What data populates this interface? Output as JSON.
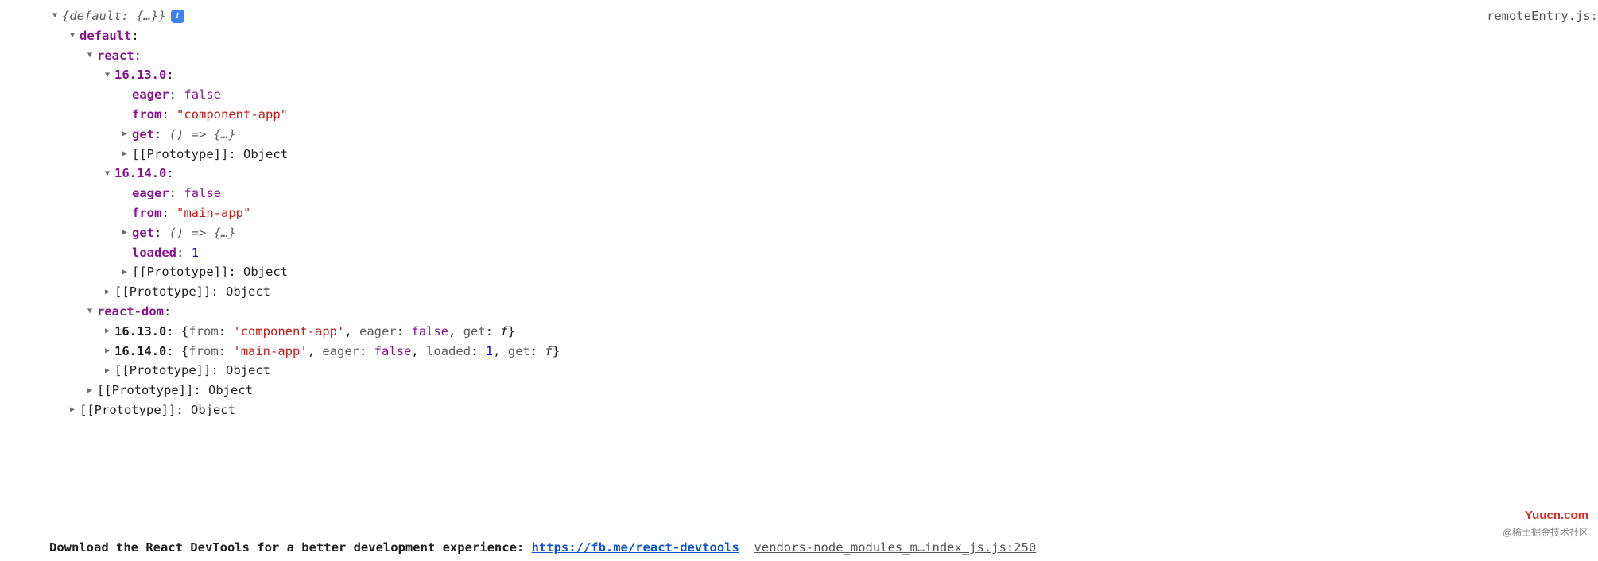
{
  "source_link": "remoteEntry.js:",
  "root": {
    "summary_prefix": "{default: ",
    "summary_inner": "{…}",
    "summary_suffix": "}",
    "info_badge": "i"
  },
  "default": {
    "key": "default",
    "react": {
      "key": "react",
      "v16_13_0": {
        "key": "16.13.0",
        "eager_key": "eager",
        "eager_val": "false",
        "from_key": "from",
        "from_val": "\"component-app\"",
        "get_key": "get",
        "get_val": "() => {…}",
        "proto_key": "[[Prototype]]",
        "proto_val": "Object"
      },
      "v16_14_0": {
        "key": "16.14.0",
        "eager_key": "eager",
        "eager_val": "false",
        "from_key": "from",
        "from_val": "\"main-app\"",
        "get_key": "get",
        "get_val": "() => {…}",
        "loaded_key": "loaded",
        "loaded_val": "1",
        "proto_key": "[[Prototype]]",
        "proto_val": "Object"
      },
      "proto_key": "[[Prototype]]",
      "proto_val": "Object"
    },
    "react_dom": {
      "key": "react-dom",
      "v16_13_0": {
        "key": "16.13.0",
        "inline_from_k": "from",
        "inline_from_v": "'component-app'",
        "inline_eager_k": "eager",
        "inline_eager_v": "false",
        "inline_get_k": "get",
        "inline_get_v": "f"
      },
      "v16_14_0": {
        "key": "16.14.0",
        "inline_from_k": "from",
        "inline_from_v": "'main-app'",
        "inline_eager_k": "eager",
        "inline_eager_v": "false",
        "inline_loaded_k": "loaded",
        "inline_loaded_v": "1",
        "inline_get_k": "get",
        "inline_get_v": "f"
      },
      "proto_key": "[[Prototype]]",
      "proto_val": "Object"
    },
    "proto_key": "[[Prototype]]",
    "proto_val": "Object"
  },
  "outer_proto_key": "[[Prototype]]",
  "outer_proto_val": "Object",
  "bottom": {
    "msg": "Download the React DevTools for a better development experience: ",
    "url": "https://fb.me/react-devtools",
    "trail": "vendors-node_modules_m…index_js.js:250"
  },
  "watermark": {
    "line1": "Yuucn.com",
    "line2": "@稀土掘金技术社区"
  }
}
